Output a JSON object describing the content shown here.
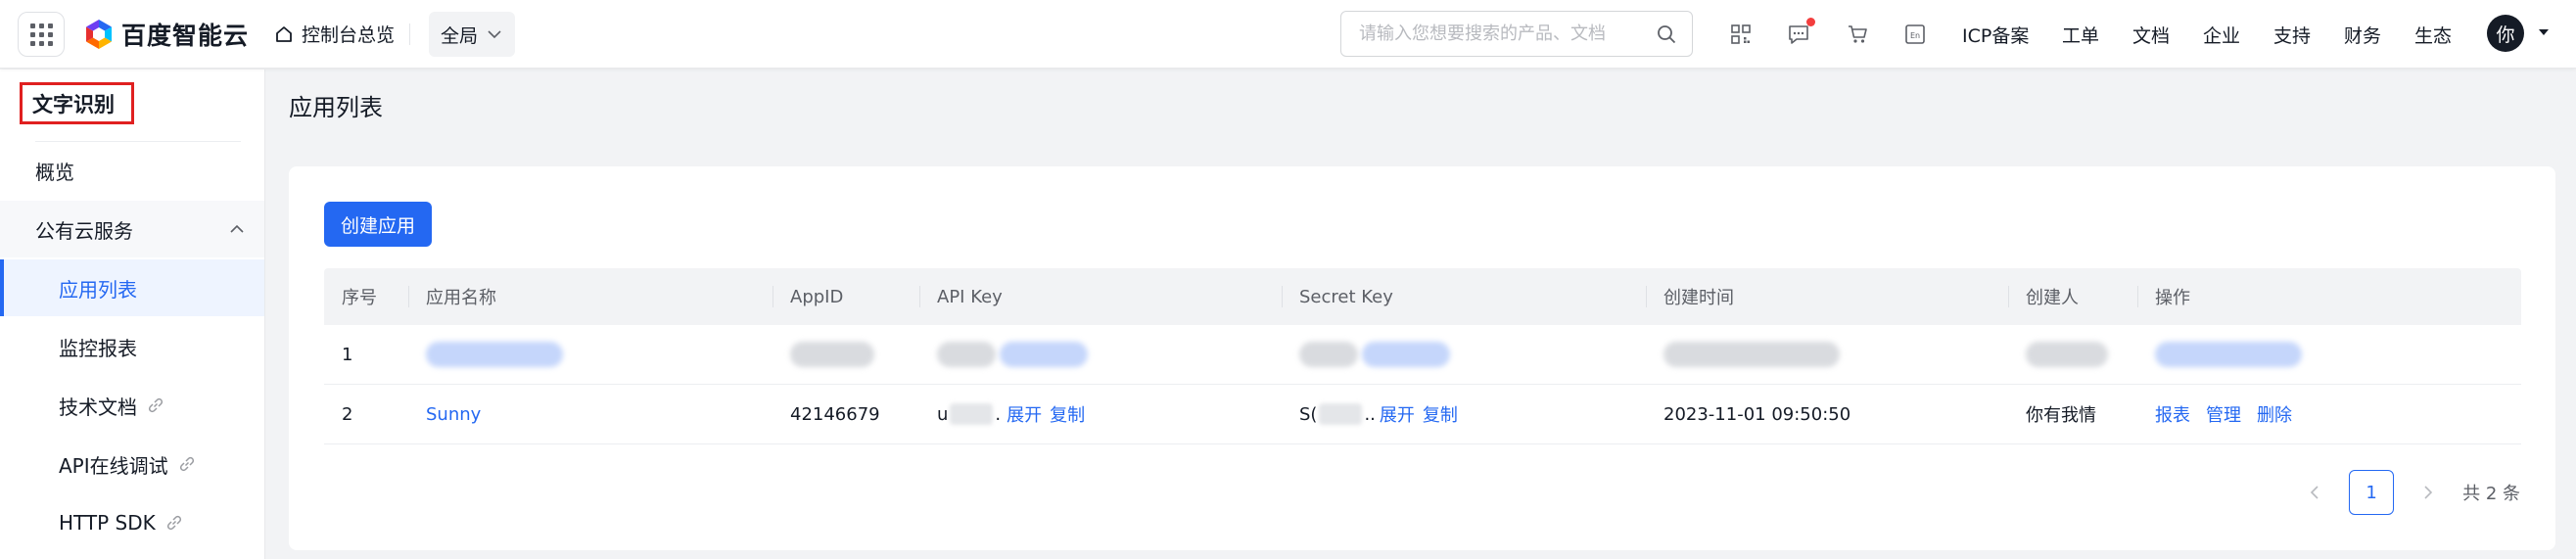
{
  "topbar": {
    "brand": "百度智能云",
    "home_label": "控制台总览",
    "region": "全局",
    "search_placeholder": "请输入您想要搜索的产品、文档",
    "nav": [
      "ICP备案",
      "工单",
      "文档",
      "企业",
      "支持",
      "财务",
      "生态"
    ],
    "avatar_text": "你",
    "icons": [
      "apps-grid-icon",
      "qrcode-icon",
      "message-icon",
      "cart-icon",
      "language-icon",
      "search-icon"
    ]
  },
  "sidebar": {
    "title": "文字识别",
    "items": [
      {
        "label": "概览"
      },
      {
        "label": "公有云服务"
      },
      {
        "label": "应用列表"
      },
      {
        "label": "监控报表"
      },
      {
        "label": "技术文档"
      },
      {
        "label": "API在线调试"
      },
      {
        "label": "HTTP SDK"
      }
    ]
  },
  "main": {
    "page_title": "应用列表",
    "create_button": "创建应用",
    "table": {
      "headers": [
        "序号",
        "应用名称",
        "AppID",
        "API Key",
        "Secret Key",
        "创建时间",
        "创建人",
        "操作"
      ],
      "rows": [
        {
          "index": "1"
        },
        {
          "index": "2",
          "name": "Sunny",
          "appid": "42146679",
          "api_key_prefix": "u",
          "api_key_suffix": ".",
          "secret_key_prefix": "S(",
          "secret_key_suffix": "..",
          "expand": "展开",
          "copy": "复制",
          "created_at": "2023-11-01 09:50:50",
          "creator": "你有我情",
          "actions": [
            "报表",
            "管理",
            "删除"
          ]
        }
      ]
    },
    "pagination": {
      "current": "1",
      "total_text": "共 2 条"
    }
  },
  "colors": {
    "primary": "#2468f2",
    "highlight_border": "#e02020"
  }
}
